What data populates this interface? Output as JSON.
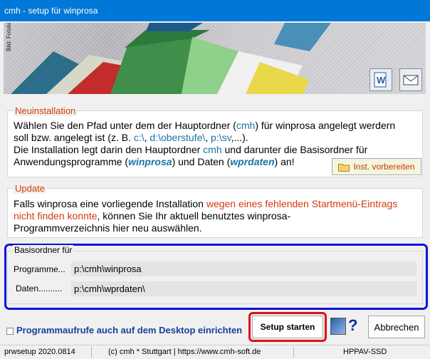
{
  "window": {
    "title": "cmh - setup für winprosa"
  },
  "banner": {
    "credit": "Bild: Fotolia"
  },
  "neuinstallation": {
    "title": "Neuinstallation",
    "line1_a": "Wählen Sie den Pfad unter dem der Hauptordner (",
    "line1_cmh": "cmh",
    "line1_b": ") für winprosa angelegt werdern",
    "line2_a": "soll bzw. angelegt ist (z. B. ",
    "line2_ex1": "c:\\",
    "line2_sep1": ", ",
    "line2_ex2": "d:\\oberstufe\\",
    "line2_sep2": ", ",
    "line2_ex3": "p:\\sv",
    "line2_b": ",...).",
    "line3_a": "Die Installation legt darin den Hauptordner ",
    "line3_cmh": "cmh",
    "line3_b": " und darunter die Basisordner für",
    "line4_a": "Anwendungsprogramme (",
    "line4_prog": "winprosa",
    "line4_b": ") und Daten  (",
    "line4_data": "wprdaten",
    "line4_c": ") an!",
    "button": "Inst. vorbereiten"
  },
  "update": {
    "title": "Update",
    "line1_a": "Falls winprosa eine vorliegende Installation ",
    "line1_red": "wegen eines fehlenden Startmenü-Eintrags",
    "line2_red": "nicht finden konnte",
    "line2_b": ", können Sie Ihr aktuell benutztes winprosa-",
    "line3": "Programmverzeichnis hier neu auswählen."
  },
  "basisordner": {
    "title": "Basisordner für",
    "programme_label": "Programme...",
    "programme_value": "p:\\cmh\\winprosa",
    "daten_label": "Daten..........",
    "daten_value": "p:\\cmh\\wprdaten\\"
  },
  "bottom": {
    "checkbox_label": "Programmaufrufe auch auf dem Desktop einrichten",
    "setup_button": "Setup starten",
    "help": "?",
    "cancel_button": "Abbrechen"
  },
  "status": {
    "version": "prwsetup 2020.0814",
    "copyright": "(c) cmh * Stuttgart | https://www.cmh-soft.de",
    "machine": "HPPAV-SSD"
  }
}
